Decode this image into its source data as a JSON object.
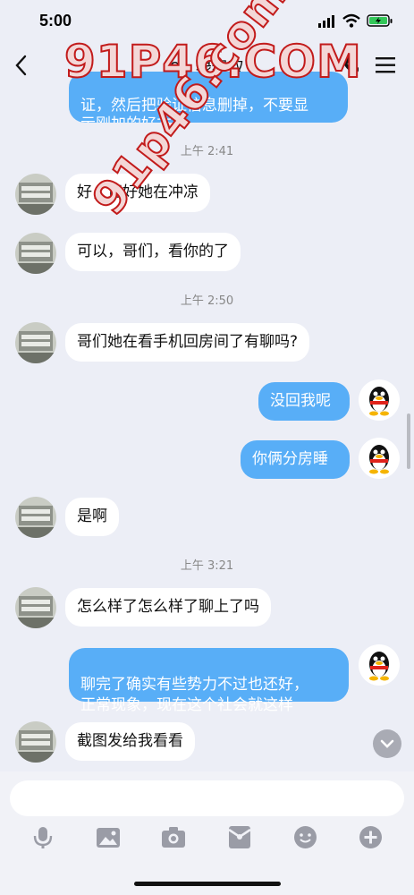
{
  "status_bar": {
    "time": "5:00"
  },
  "header": {
    "title": "91 绿绿双"
  },
  "watermark": {
    "main": "91P46.COM",
    "diagonal": "91p46.com"
  },
  "messages": {
    "m0": "证，然后把验证信息删掉，不要显\n示刚加的好友",
    "t1": "上午 2:41",
    "m1": "好，正好她在冲凉",
    "m2": "可以，哥们，看你的了",
    "t2": "上午 2:50",
    "m3": "哥们她在看手机回房间了有聊吗?",
    "m4": "没回我呢",
    "m5": "你俩分房睡",
    "m6": "是啊",
    "t3": "上午 3:21",
    "m7": "怎么样了怎么样了聊上了吗",
    "m8": "聊完了确实有些势力不过也还好，\n正常现象，现在这个社会就这样",
    "m9": "截图发给我看看"
  },
  "input_bar": {
    "value": ""
  },
  "toolbar": {
    "icons": [
      "microphone-icon",
      "image-icon",
      "camera-icon",
      "red-packet-icon",
      "emoji-icon",
      "plus-icon"
    ]
  },
  "colors": {
    "outgoing": "#58aef7",
    "incoming": "#ffffff",
    "background": "#eceef6"
  }
}
